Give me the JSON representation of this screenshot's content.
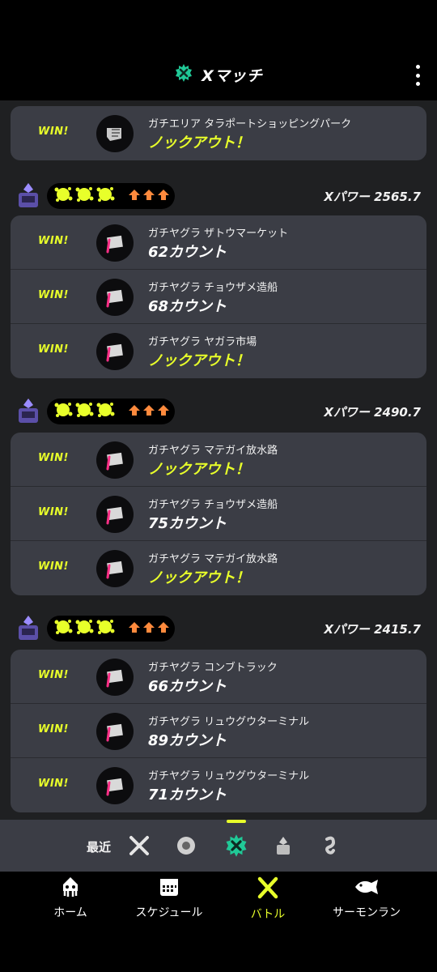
{
  "header": {
    "title": "Xマッチ",
    "colors": {
      "accent": "#e8ff2a",
      "x_icon": "#20c997"
    }
  },
  "groups": [
    {
      "x_power_label": "",
      "rows": [
        {
          "win": "WIN!",
          "stage": "ガチエリア タラポートショッピングパーク",
          "result": "ノックアウト！",
          "result_type": "ko"
        }
      ]
    },
    {
      "x_power_label": "Xパワー 2565.7",
      "rows": [
        {
          "win": "WIN!",
          "stage": "ガチヤグラ ザトウマーケット",
          "result": "62カウント",
          "result_type": "count"
        },
        {
          "win": "WIN!",
          "stage": "ガチヤグラ チョウザメ造船",
          "result": "68カウント",
          "result_type": "count"
        },
        {
          "win": "WIN!",
          "stage": "ガチヤグラ ヤガラ市場",
          "result": "ノックアウト！",
          "result_type": "ko"
        }
      ]
    },
    {
      "x_power_label": "Xパワー 2490.7",
      "rows": [
        {
          "win": "WIN!",
          "stage": "ガチヤグラ マテガイ放水路",
          "result": "ノックアウト！",
          "result_type": "ko"
        },
        {
          "win": "WIN!",
          "stage": "ガチヤグラ チョウザメ造船",
          "result": "75カウント",
          "result_type": "count"
        },
        {
          "win": "WIN!",
          "stage": "ガチヤグラ マテガイ放水路",
          "result": "ノックアウト！",
          "result_type": "ko"
        }
      ]
    },
    {
      "x_power_label": "Xパワー 2415.7",
      "rows": [
        {
          "win": "WIN!",
          "stage": "ガチヤグラ コンブトラック",
          "result": "66カウント",
          "result_type": "count"
        },
        {
          "win": "WIN!",
          "stage": "ガチヤグラ リュウグウターミナル",
          "result": "89カウント",
          "result_type": "count"
        },
        {
          "win": "WIN!",
          "stage": "ガチヤグラ リュウグウターミナル",
          "result": "71カウント",
          "result_type": "count"
        }
      ]
    }
  ],
  "filter": {
    "label": "最近",
    "items": [
      "regular-battle-icon",
      "bankara-battle-icon",
      "x-match-icon",
      "league-icon",
      "private-icon"
    ],
    "selected": "x-match-icon"
  },
  "nav": {
    "items": [
      {
        "label": "ホーム",
        "icon": "squid-icon"
      },
      {
        "label": "スケジュール",
        "icon": "calendar-icon"
      },
      {
        "label": "バトル",
        "icon": "battle-icon"
      },
      {
        "label": "サーモンラン",
        "icon": "salmon-icon"
      }
    ],
    "active": "バトル"
  }
}
